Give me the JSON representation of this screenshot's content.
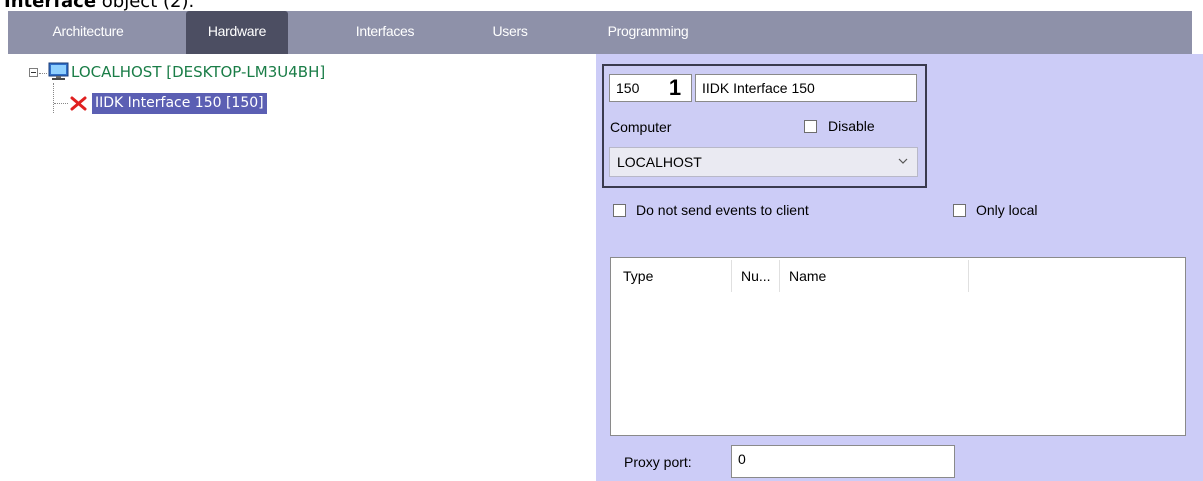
{
  "caption": {
    "bold": "Interface",
    "rest": " object (2)."
  },
  "tabs": [
    "Architecture",
    "Hardware",
    "Interfaces",
    "Users",
    "Programming"
  ],
  "active_tab": "Hardware",
  "tree": {
    "root_label": "LOCALHOST [DESKTOP-LM3U4BH]",
    "child_label": "IIDK Interface 150 [150]"
  },
  "props": {
    "id_value": "150",
    "marker": "1",
    "name_value": "IIDK Interface 150",
    "computer_label": "Computer",
    "disable_label": "Disable",
    "disable_checked": false,
    "computer_value": "LOCALHOST",
    "no_events_label": "Do not send events to client",
    "no_events_checked": false,
    "only_local_label": "Only local",
    "only_local_checked": false,
    "columns": [
      "Type",
      "Nu...",
      "Name"
    ],
    "proxy_label": "Proxy port:",
    "proxy_value": "0"
  },
  "colors": {
    "tab_bar": "#8e91a9",
    "tab_active": "#4c4e62",
    "panel_bg": "#ccccf7",
    "tree_root_text": "#1a7d47",
    "selection": "#5b5fb3",
    "error_x": "#e02020"
  },
  "icons": [
    "monitor-icon",
    "error-x-icon",
    "chevron-down-icon"
  ]
}
